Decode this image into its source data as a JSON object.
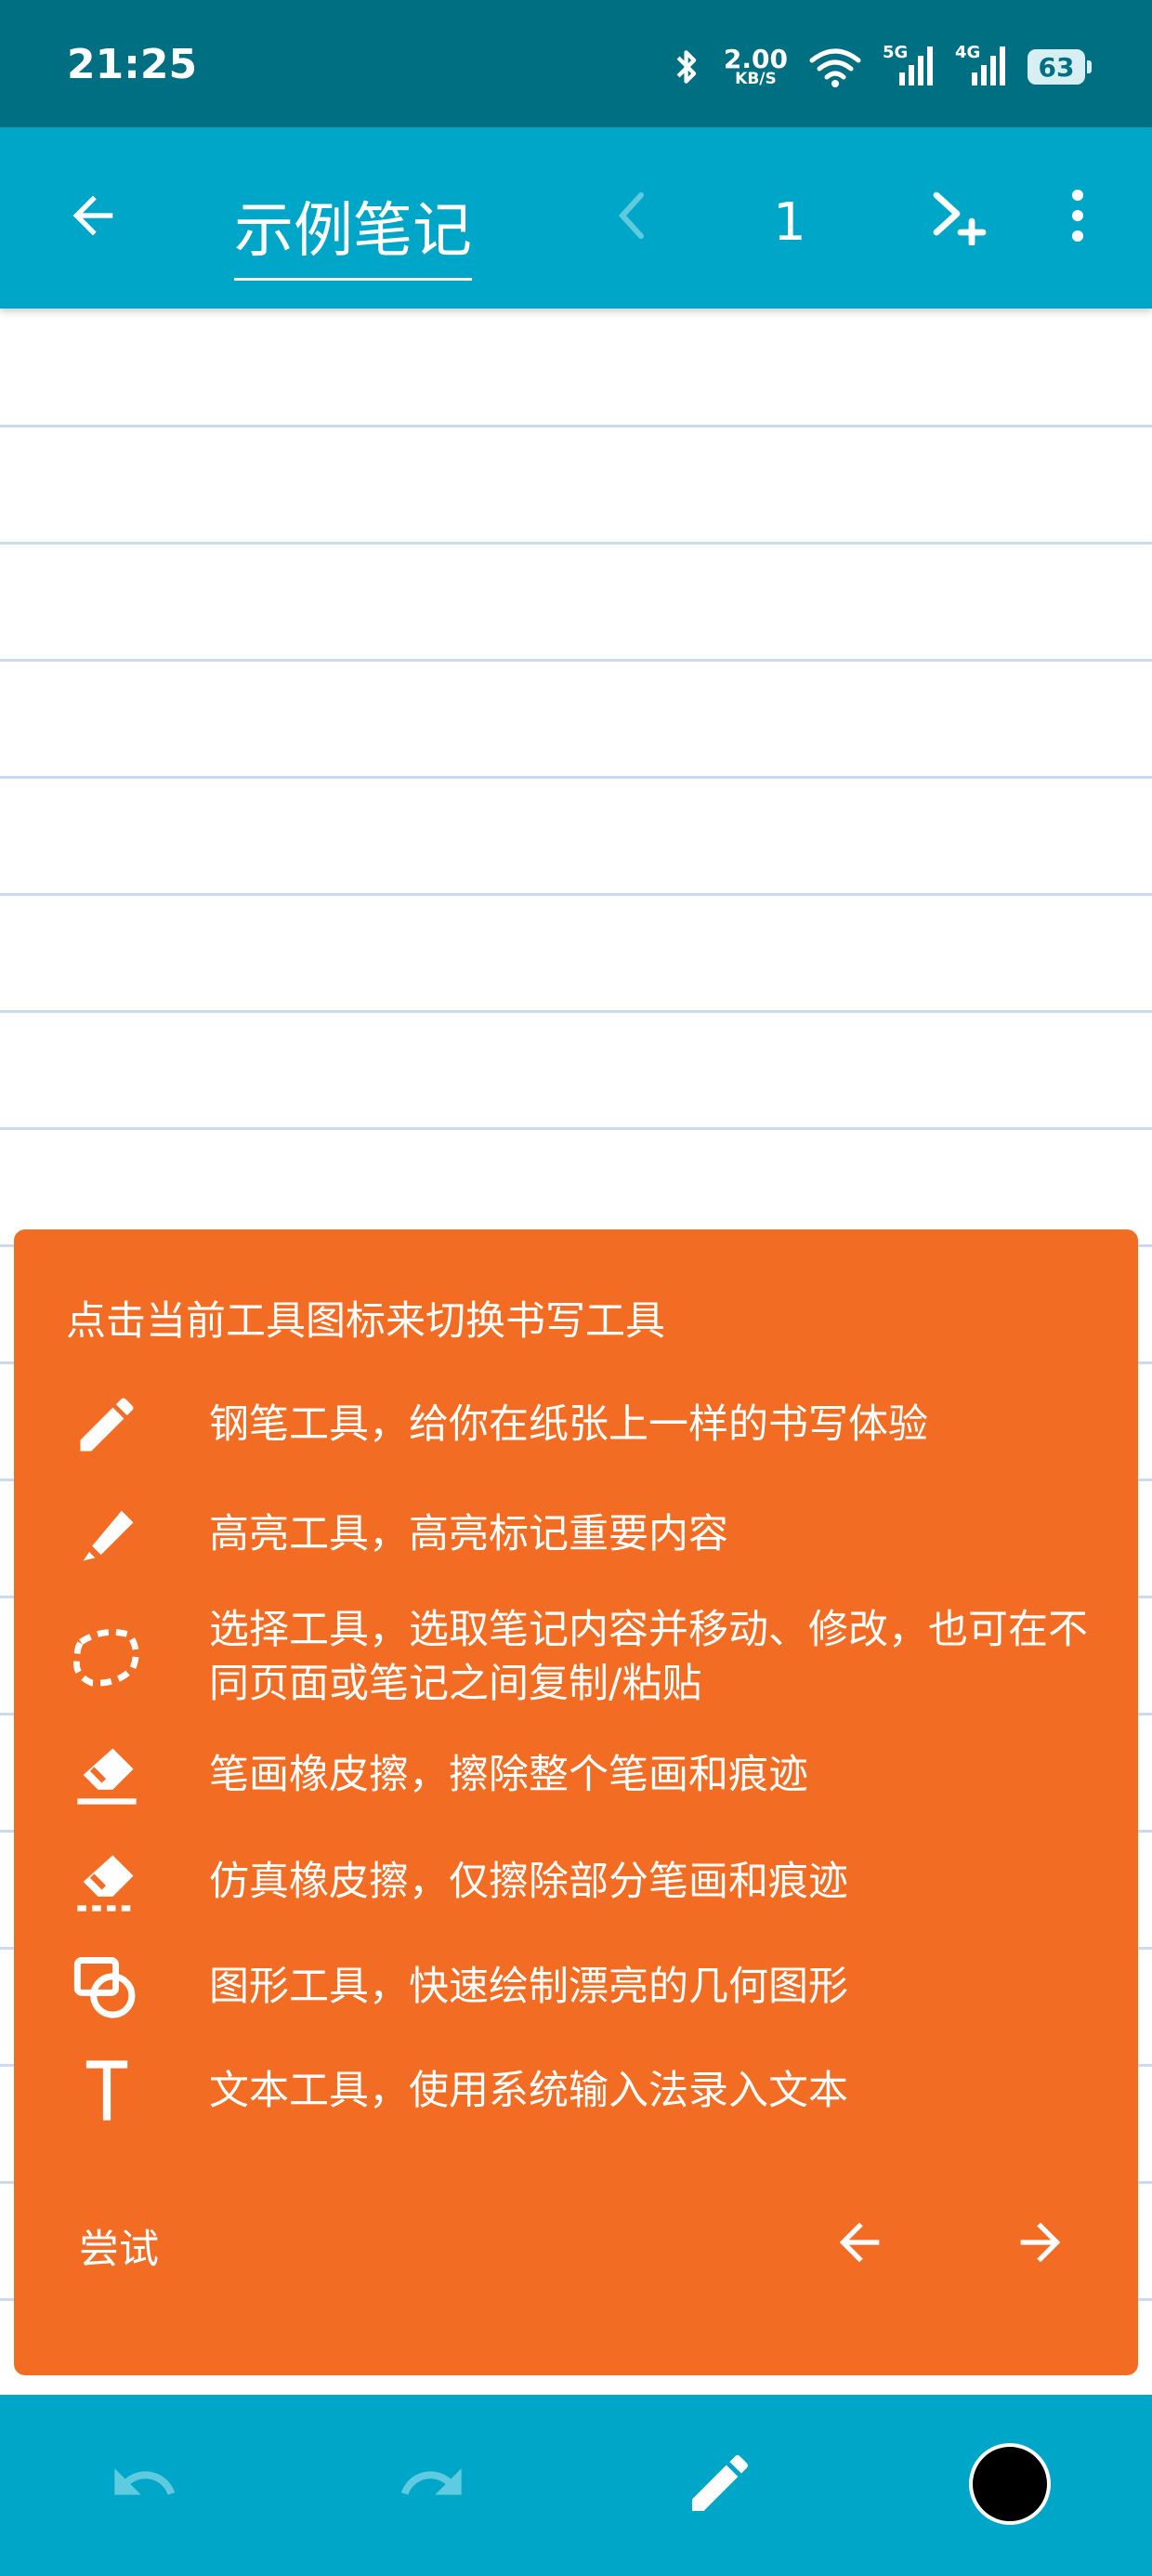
{
  "status_bar": {
    "time": "21:25",
    "net_speed_value": "2.00",
    "net_speed_unit": "KB/S",
    "sim1_label": "5G",
    "sim2_label": "4G",
    "battery": "63",
    "icons": [
      "bluetooth-icon",
      "wifi-icon",
      "signal-5g-icon",
      "signal-4g-icon",
      "battery-icon"
    ]
  },
  "app_bar": {
    "title": "示例笔记",
    "page_number": "1",
    "icons": [
      "back-arrow-icon",
      "prev-page-icon",
      "next-page-add-icon",
      "more-vert-icon"
    ]
  },
  "tutorial": {
    "heading": "点击当前工具图标来切换书写工具",
    "items": [
      {
        "icon": "pen-icon",
        "text": "钢笔工具，给你在纸张上一样的书写体验"
      },
      {
        "icon": "highlighter-icon",
        "text": "高亮工具，高亮标记重要内容"
      },
      {
        "icon": "lasso-select-icon",
        "text": "选择工具，选取笔记内容并移动、修改，也可在不同页面或笔记之间复制/粘贴"
      },
      {
        "icon": "stroke-eraser-icon",
        "text": "笔画橡皮擦，擦除整个笔画和痕迹"
      },
      {
        "icon": "pixel-eraser-icon",
        "text": "仿真橡皮擦，仅擦除部分笔画和痕迹"
      },
      {
        "icon": "shape-tool-icon",
        "text": "图形工具，快速绘制漂亮的几何图形"
      },
      {
        "icon": "text-tool-icon",
        "text": "文本工具，使用系统输入法录入文本"
      }
    ],
    "try_label": "尝试"
  },
  "bottom_bar": {
    "icons": [
      "undo-icon",
      "redo-icon",
      "pen-tool-icon",
      "color-swatch"
    ],
    "current_color": "#000000"
  },
  "colors": {
    "status_bar": "#006f81",
    "app_bar": "#00a6c7",
    "tutorial_panel": "#f26c24",
    "ruled_line": "#c9daf2"
  }
}
